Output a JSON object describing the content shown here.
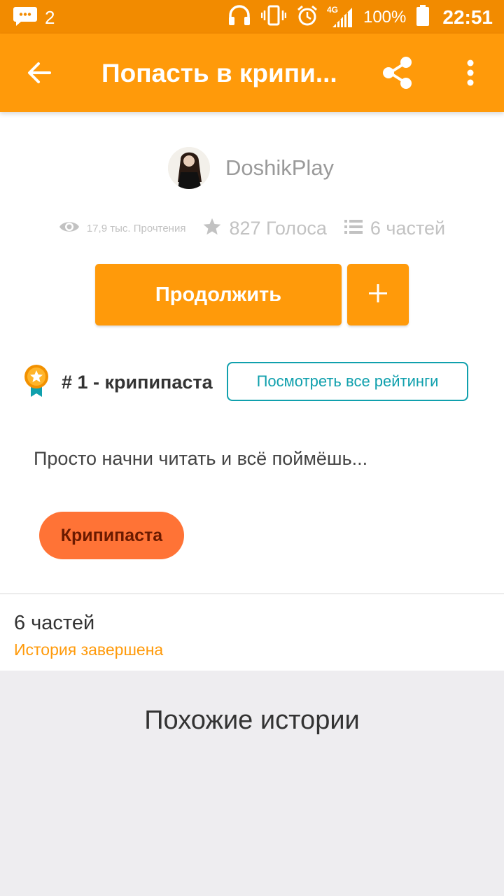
{
  "status_bar": {
    "notification_count": "2",
    "network": "4G",
    "battery": "100%",
    "time": "22:51",
    "icons": [
      "message-icon",
      "headphones-icon",
      "vibrate-icon",
      "alarm-icon",
      "signal-icon",
      "battery-icon"
    ]
  },
  "app_bar": {
    "title": "Попасть в крипи...",
    "background": "#ff9a0a"
  },
  "author": {
    "name": "DoshikPlay"
  },
  "stats": {
    "reads": "17,9 тыс. Прочтения",
    "votes": "827 Голоса",
    "parts": "6 частей"
  },
  "actions": {
    "continue_label": "Продолжить",
    "add_label": "+"
  },
  "ranking": {
    "text": "# 1 - крипипаста",
    "view_all_label": "Посмотреть все рейтинги"
  },
  "description": "Просто начни читать и всё поймёшь...",
  "tags": [
    "Крипипаста"
  ],
  "parts_section": {
    "title": "6 частей",
    "status": "История завершена"
  },
  "similar": {
    "title": "Похожие истории"
  },
  "colors": {
    "accent": "#ff9a0a",
    "status_bar": "#f28b00",
    "teal": "#10a0ad",
    "tag": "#ff7336"
  }
}
